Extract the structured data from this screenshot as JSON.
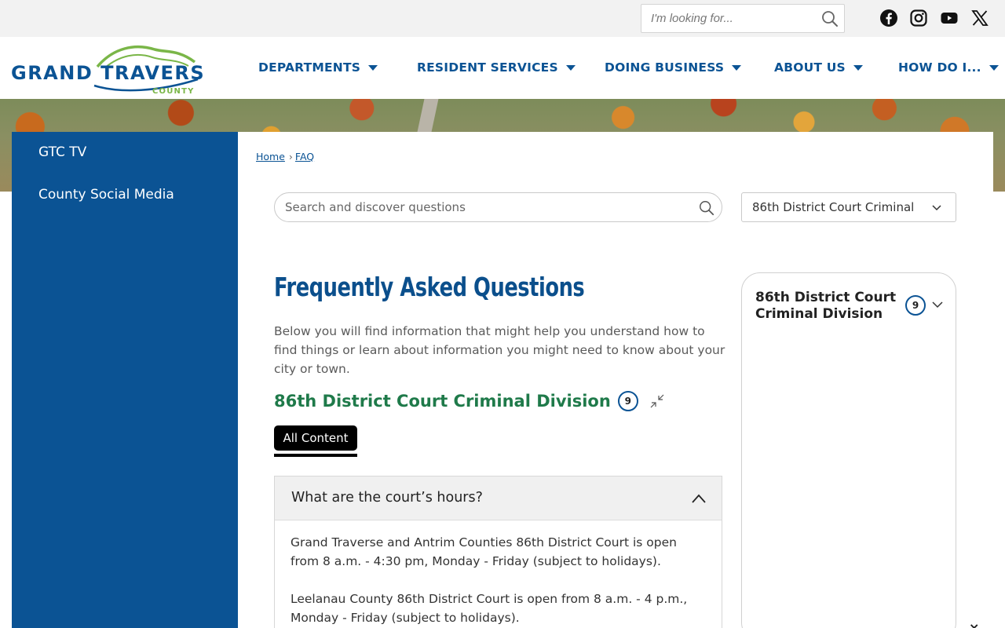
{
  "topbar": {
    "search_placeholder": "I'm looking for...",
    "social": [
      "facebook-icon",
      "instagram-icon",
      "youtube-icon",
      "x-icon"
    ]
  },
  "logo": {
    "name": "GRAND TRAVERSE",
    "sub": "COUNTY",
    "brand_blue": "#0b5394",
    "brand_green": "#7ab648"
  },
  "nav": [
    {
      "label": "DEPARTMENTS"
    },
    {
      "label": "RESIDENT SERVICES"
    },
    {
      "label": "DOING BUSINESS"
    },
    {
      "label": "ABOUT US"
    },
    {
      "label": "HOW DO I..."
    }
  ],
  "sidebar": {
    "items": [
      {
        "label": "GTC TV"
      },
      {
        "label": "County Social Media"
      }
    ]
  },
  "breadcrumb": {
    "home": "Home",
    "sep": "›",
    "current": "FAQ"
  },
  "faq_search": {
    "placeholder": "Search and discover questions"
  },
  "category_select": {
    "value": "86th District Court Criminal"
  },
  "page": {
    "title": "Frequently Asked Questions",
    "intro": "Below you will find information that might help you understand how to find things or learn about information you might need to know about your city or town."
  },
  "category": {
    "name": "86th District Court Criminal Division",
    "count": "9"
  },
  "filter": {
    "label": "All Content"
  },
  "faq": {
    "question": "What are the court’s hours?",
    "answers": [
      "Grand Traverse and Antrim Counties 86th District Court is open from 8 a.m. - 4:30 pm, Monday - Friday (subject to holidays).",
      "Leelanau County 86th District Court is open from 8 a.m. - 4 p.m., Monday - Friday (subject to holidays)."
    ]
  },
  "panel": {
    "title": "86th District Court Criminal Division",
    "count": "9"
  },
  "close": {
    "label": "×"
  }
}
